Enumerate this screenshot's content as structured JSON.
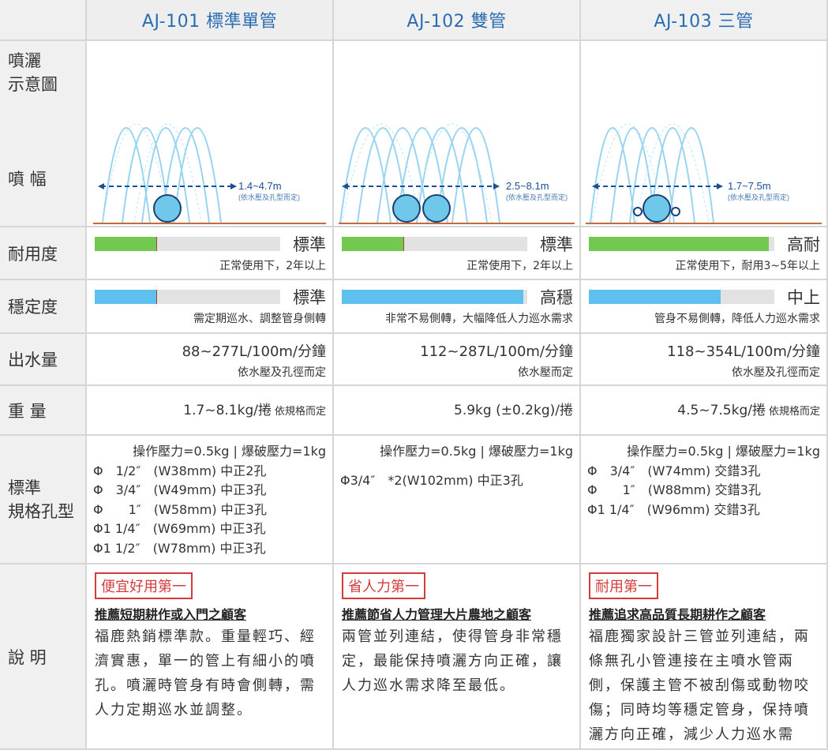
{
  "columns": [
    {
      "title": "AJ-101 標準單管"
    },
    {
      "title": "AJ-102 雙管"
    },
    {
      "title": "AJ-103 三管"
    }
  ],
  "row_labels": {
    "spray_line1": "噴灑",
    "spray_line2": "示意圖",
    "width": "噴 幅",
    "durability": "耐用度",
    "stability": "穩定度",
    "flow": "出水量",
    "weight": "重 量",
    "spec_line1": "標準",
    "spec_line2": "規格孔型",
    "desc": "說 明"
  },
  "spray": [
    {
      "range": "1.4~4.7m",
      "note": "(依水壓及孔型而定)"
    },
    {
      "range": "2.5~8.1m",
      "note": "(依水壓及孔型而定)"
    },
    {
      "range": "1.7~7.5m",
      "note": "(依水壓及孔型而定)"
    }
  ],
  "durability": [
    {
      "level": 0.33,
      "word": "標準",
      "note": "正常使用下，2年以上"
    },
    {
      "level": 0.33,
      "word": "標準",
      "note": "正常使用下，2年以上"
    },
    {
      "level": 0.97,
      "word": "高耐",
      "note": "正常使用下，耐用3~5年以上"
    }
  ],
  "stability": [
    {
      "level": 0.33,
      "word": "標準",
      "note": "需定期巡水、調整管身側轉"
    },
    {
      "level": 0.98,
      "word": "高穩",
      "note": "非常不易側轉，大幅降低人力巡水需求"
    },
    {
      "level": 0.71,
      "word": "中上",
      "note": "管身不易側轉，降低人力巡水需求"
    }
  ],
  "flow": [
    {
      "main": "88~277L/100m/分鐘",
      "sub": "依水壓及孔徑而定"
    },
    {
      "main": "112~287L/100m/分鐘",
      "sub": "依水壓而定"
    },
    {
      "main": "118~354L/100m/分鐘",
      "sub": "依水壓及孔徑而定"
    }
  ],
  "weight": [
    {
      "main": "1.7~8.1kg/捲",
      "note": "依規格而定"
    },
    {
      "main": "5.9kg (±0.2kg)/捲",
      "note": ""
    },
    {
      "main": "4.5~7.5kg/捲",
      "note": "依規格而定"
    }
  ],
  "specs": [
    {
      "pressure": "操作壓力=0.5kg | 爆破壓力=1kg",
      "lines": [
        "Φ　1/2″　(W38mm) 中正2孔",
        "Φ　3/4″　(W49mm) 中正3孔",
        "Φ　　1″　(W58mm) 中正3孔",
        "Φ1 1/4″　(W69mm) 中正3孔",
        "Φ1 1/2″　(W78mm) 中正3孔"
      ]
    },
    {
      "pressure": "操作壓力=0.5kg | 爆破壓力=1kg",
      "lines": [
        "Φ3/4″　*2(W102mm) 中正3孔"
      ]
    },
    {
      "pressure": "操作壓力=0.5kg | 爆破壓力=1kg",
      "lines": [
        "Φ　3/4″　(W74mm) 交錯3孔",
        "Φ　　1″　(W88mm) 交錯3孔",
        "Φ1 1/4″　(W96mm) 交錯3孔"
      ]
    }
  ],
  "descriptions": [
    {
      "badge": "便宜好用第一",
      "title": "推薦短期耕作或入門之顧客",
      "body": "福鹿熱銷標準款。重量輕巧、經濟實惠，單一的管上有細小的噴孔。噴灑時管身有時會側轉，需人力定期巡水並調整。"
    },
    {
      "badge": "省人力第一",
      "title": "推薦節省人力管理大片農地之顧客",
      "body": "兩管並列連結，使得管身非常穩定，最能保持噴灑方向正確，讓人力巡水需求降至最低。"
    },
    {
      "badge": "耐用第一",
      "title": "推薦追求高品質長期耕作之顧客",
      "body": "福鹿獨家設計三管並列連結，兩條無孔小管連接在主噴水管兩側，保護主管不被刮傷或動物咬傷；同時均等穩定管身，保持噴灑方向正確，減少人力巡水需求。"
    }
  ],
  "colors": {
    "green": "#73c84f",
    "blue": "#5dc0ee",
    "header_text": "#2a6cb2",
    "badge": "#d23c3c"
  }
}
